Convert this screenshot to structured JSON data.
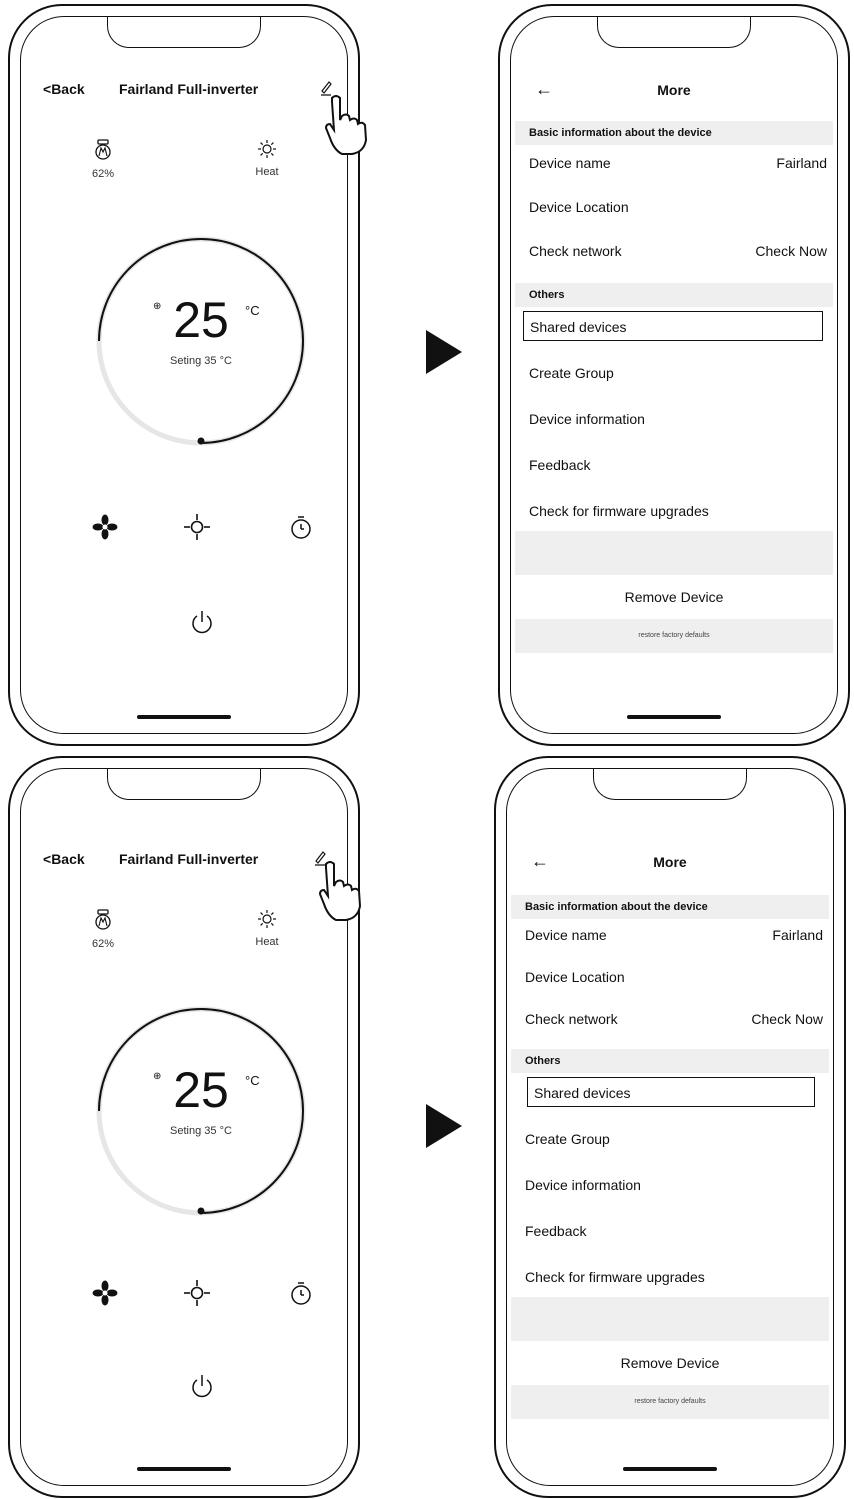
{
  "control": {
    "back_label": "Back",
    "title": "Fairland Full-inverter",
    "status_left": {
      "icon": "fan-speed-icon",
      "label": "62%"
    },
    "status_right": {
      "icon": "sun-icon",
      "label": "Heat"
    },
    "temperature": "25",
    "unit": "°C",
    "setting": "Seting 35 °C"
  },
  "more": {
    "title": "More",
    "section_basic": "Basic information about the device",
    "device_name_label": "Device name",
    "device_name_value": "Fairland",
    "device_location": "Device Location",
    "check_network_label": "Check network",
    "check_network_value": "Check Now",
    "section_others": "Others",
    "shared_devices": "Shared devices",
    "create_group": "Create Group",
    "device_information": "Device information",
    "feedback": "Feedback",
    "firmware": "Check for firmware upgrades",
    "remove_device": "Remove Device",
    "restore": "restore factory defaults"
  },
  "colors": {
    "ink": "#111111",
    "band": "#efefef"
  }
}
